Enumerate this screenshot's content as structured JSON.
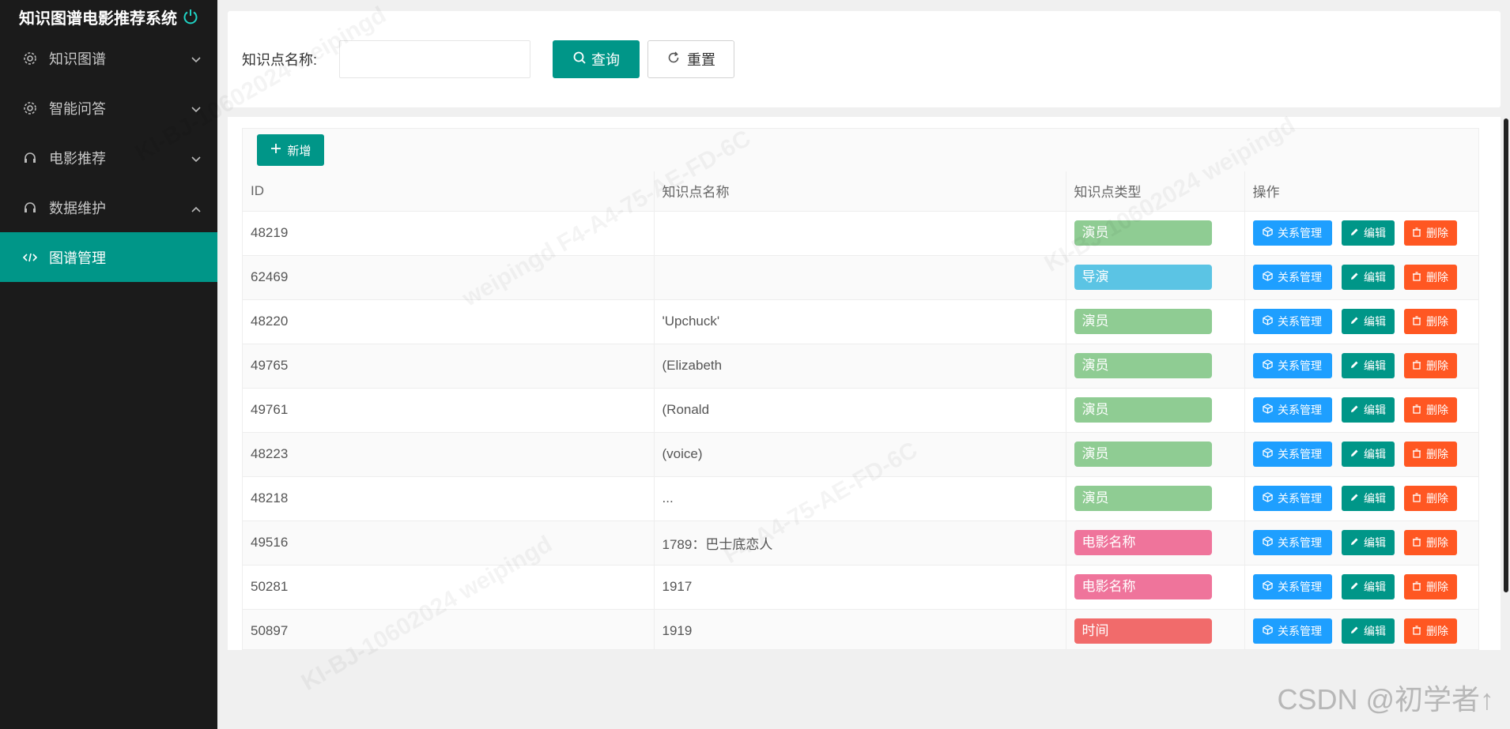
{
  "app_title": "知识图谱电影推荐系统",
  "sidebar": {
    "items": [
      {
        "label": "知识图谱",
        "icon": "gear-icon",
        "expanded": false
      },
      {
        "label": "智能问答",
        "icon": "gear-icon",
        "expanded": false
      },
      {
        "label": "电影推荐",
        "icon": "headset-icon",
        "expanded": false
      },
      {
        "label": "数据维护",
        "icon": "headset-icon",
        "expanded": true
      },
      {
        "label": "图谱管理",
        "icon": "code-icon",
        "active": true
      }
    ]
  },
  "search": {
    "label": "知识点名称:",
    "placeholder": "",
    "value": "",
    "query_label": "查询",
    "reset_label": "重置"
  },
  "toolbar": {
    "add_label": "新增"
  },
  "table": {
    "columns": [
      "ID",
      "知识点名称",
      "知识点类型",
      "操作"
    ],
    "rows": [
      {
        "id": "48219",
        "name": "",
        "type": "演员"
      },
      {
        "id": "62469",
        "name": "",
        "type": "导演"
      },
      {
        "id": "48220",
        "name": "'Upchuck'",
        "type": "演员"
      },
      {
        "id": "49765",
        "name": "(Elizabeth",
        "type": "演员"
      },
      {
        "id": "49761",
        "name": "(Ronald",
        "type": "演员"
      },
      {
        "id": "48223",
        "name": "(voice)",
        "type": "演员"
      },
      {
        "id": "48218",
        "name": "...",
        "type": "演员"
      },
      {
        "id": "49516",
        "name": "1789：巴士底恋人",
        "type": "电影名称"
      },
      {
        "id": "50281",
        "name": "1917",
        "type": "电影名称"
      },
      {
        "id": "50897",
        "name": "1919",
        "type": "时间"
      }
    ],
    "ops": {
      "relation": "关系管理",
      "edit": "编辑",
      "delete": "删除"
    }
  },
  "type_colors": {
    "演员": "#8fcc93",
    "导演": "#5bc4e4",
    "电影名称": "#ef749b",
    "时间": "#f16b6b"
  },
  "colors": {
    "accent": "#009688",
    "sidebar_bg": "#1b1b1b",
    "relation": "#1e9fff",
    "delete": "#ff5722"
  },
  "watermarks": [
    "KI-BJ-10602024 weipingd",
    "weipingd F4-A4-75-AE-FD-6C",
    "KI-BJ-10602024 weipingd",
    "F4-A4-75-AE-FD-6C",
    "KI-BJ-10602024 weipingd"
  ],
  "footer_mark": "CSDN @初学者↑"
}
